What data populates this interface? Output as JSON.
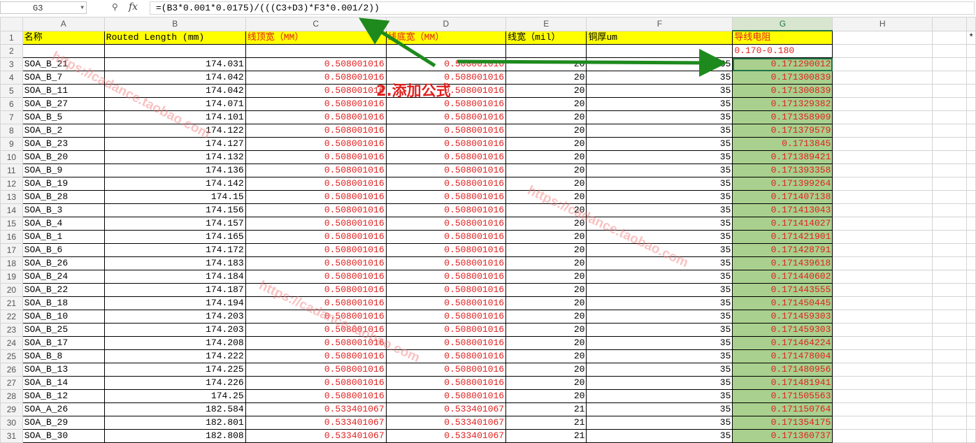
{
  "formula_bar": {
    "name_box": "G3",
    "fx_label": "fx",
    "formula": "=(B3*0.001*0.0175)/(((C3+D3)*F3*0.001/2))"
  },
  "columns": [
    "A",
    "B",
    "C",
    "D",
    "E",
    "F",
    "G",
    "H"
  ],
  "extra_cell": "*",
  "header_row": {
    "number": "1",
    "cells": [
      "名称",
      "Routed Length (mm)",
      "线顶宽（MM）",
      "线底宽（MM）",
      "线宽（mil）",
      "铜厚um",
      "导线电阻",
      ""
    ]
  },
  "range_row": {
    "number": "2",
    "g_value": "0.170-0.180"
  },
  "rows": [
    {
      "n": "3",
      "name": "SOA_B_21",
      "len": "174.031",
      "top": "0.508001016",
      "bot": "0.508001016",
      "mil": "20",
      "cu": "35",
      "res": "0.171290012"
    },
    {
      "n": "4",
      "name": "SOA_B_7",
      "len": "174.042",
      "top": "0.508001016",
      "bot": "0.508001016",
      "mil": "20",
      "cu": "35",
      "res": "0.171300839"
    },
    {
      "n": "5",
      "name": "SOA_B_11",
      "len": "174.042",
      "top": "0.508001016",
      "bot": "0.508001016",
      "mil": "20",
      "cu": "35",
      "res": "0.171300839"
    },
    {
      "n": "6",
      "name": "SOA_B_27",
      "len": "174.071",
      "top": "0.508001016",
      "bot": "0.508001016",
      "mil": "20",
      "cu": "35",
      "res": "0.171329382"
    },
    {
      "n": "7",
      "name": "SOA_B_5",
      "len": "174.101",
      "top": "0.508001016",
      "bot": "0.508001016",
      "mil": "20",
      "cu": "35",
      "res": "0.171358909"
    },
    {
      "n": "8",
      "name": "SOA_B_2",
      "len": "174.122",
      "top": "0.508001016",
      "bot": "0.508001016",
      "mil": "20",
      "cu": "35",
      "res": "0.171379579"
    },
    {
      "n": "9",
      "name": "SOA_B_23",
      "len": "174.127",
      "top": "0.508001016",
      "bot": "0.508001016",
      "mil": "20",
      "cu": "35",
      "res": "0.1713845"
    },
    {
      "n": "10",
      "name": "SOA_B_20",
      "len": "174.132",
      "top": "0.508001016",
      "bot": "0.508001016",
      "mil": "20",
      "cu": "35",
      "res": "0.171389421"
    },
    {
      "n": "11",
      "name": "SOA_B_9",
      "len": "174.136",
      "top": "0.508001016",
      "bot": "0.508001016",
      "mil": "20",
      "cu": "35",
      "res": "0.171393358"
    },
    {
      "n": "12",
      "name": "SOA_B_19",
      "len": "174.142",
      "top": "0.508001016",
      "bot": "0.508001016",
      "mil": "20",
      "cu": "35",
      "res": "0.171399264"
    },
    {
      "n": "13",
      "name": "SOA_B_28",
      "len": "174.15",
      "top": "0.508001016",
      "bot": "0.508001016",
      "mil": "20",
      "cu": "35",
      "res": "0.171407138"
    },
    {
      "n": "14",
      "name": "SOA_B_3",
      "len": "174.156",
      "top": "0.508001016",
      "bot": "0.508001016",
      "mil": "20",
      "cu": "35",
      "res": "0.171413043"
    },
    {
      "n": "15",
      "name": "SOA_B_4",
      "len": "174.157",
      "top": "0.508001016",
      "bot": "0.508001016",
      "mil": "20",
      "cu": "35",
      "res": "0.171414027"
    },
    {
      "n": "16",
      "name": "SOA_B_1",
      "len": "174.165",
      "top": "0.508001016",
      "bot": "0.508001016",
      "mil": "20",
      "cu": "35",
      "res": "0.171421901"
    },
    {
      "n": "17",
      "name": "SOA_B_6",
      "len": "174.172",
      "top": "0.508001016",
      "bot": "0.508001016",
      "mil": "20",
      "cu": "35",
      "res": "0.171428791"
    },
    {
      "n": "18",
      "name": "SOA_B_26",
      "len": "174.183",
      "top": "0.508001016",
      "bot": "0.508001016",
      "mil": "20",
      "cu": "35",
      "res": "0.171439618"
    },
    {
      "n": "19",
      "name": "SOA_B_24",
      "len": "174.184",
      "top": "0.508001016",
      "bot": "0.508001016",
      "mil": "20",
      "cu": "35",
      "res": "0.171440602"
    },
    {
      "n": "20",
      "name": "SOA_B_22",
      "len": "174.187",
      "top": "0.508001016",
      "bot": "0.508001016",
      "mil": "20",
      "cu": "35",
      "res": "0.171443555"
    },
    {
      "n": "21",
      "name": "SOA_B_18",
      "len": "174.194",
      "top": "0.508001016",
      "bot": "0.508001016",
      "mil": "20",
      "cu": "35",
      "res": "0.171450445"
    },
    {
      "n": "22",
      "name": "SOA_B_10",
      "len": "174.203",
      "top": "0.508001016",
      "bot": "0.508001016",
      "mil": "20",
      "cu": "35",
      "res": "0.171459303"
    },
    {
      "n": "23",
      "name": "SOA_B_25",
      "len": "174.203",
      "top": "0.508001016",
      "bot": "0.508001016",
      "mil": "20",
      "cu": "35",
      "res": "0.171459303"
    },
    {
      "n": "24",
      "name": "SOA_B_17",
      "len": "174.208",
      "top": "0.508001016",
      "bot": "0.508001016",
      "mil": "20",
      "cu": "35",
      "res": "0.171464224"
    },
    {
      "n": "25",
      "name": "SOA_B_8",
      "len": "174.222",
      "top": "0.508001016",
      "bot": "0.508001016",
      "mil": "20",
      "cu": "35",
      "res": "0.171478004"
    },
    {
      "n": "26",
      "name": "SOA_B_13",
      "len": "174.225",
      "top": "0.508001016",
      "bot": "0.508001016",
      "mil": "20",
      "cu": "35",
      "res": "0.171480956"
    },
    {
      "n": "27",
      "name": "SOA_B_14",
      "len": "174.226",
      "top": "0.508001016",
      "bot": "0.508001016",
      "mil": "20",
      "cu": "35",
      "res": "0.171481941"
    },
    {
      "n": "28",
      "name": "SOA_B_12",
      "len": "174.25",
      "top": "0.508001016",
      "bot": "0.508001016",
      "mil": "20",
      "cu": "35",
      "res": "0.171505563"
    },
    {
      "n": "29",
      "name": "SOA_A_26",
      "len": "182.584",
      "top": "0.533401067",
      "bot": "0.533401067",
      "mil": "21",
      "cu": "35",
      "res": "0.171150764"
    },
    {
      "n": "30",
      "name": "SOA_B_29",
      "len": "182.801",
      "top": "0.533401067",
      "bot": "0.533401067",
      "mil": "21",
      "cu": "35",
      "res": "0.171354175"
    },
    {
      "n": "31",
      "name": "SOA_B_30",
      "len": "182.808",
      "top": "0.533401067",
      "bot": "0.533401067",
      "mil": "21",
      "cu": "35",
      "res": "0.171360737"
    }
  ],
  "annotation": {
    "text": "2.添加公式"
  },
  "watermark": "https://cadance.taobao.com",
  "colors": {
    "header_yellow": "#ffff00",
    "value_red": "#e0201e",
    "result_green": "#a9d08e",
    "arrow_green": "#1e8a1e"
  }
}
